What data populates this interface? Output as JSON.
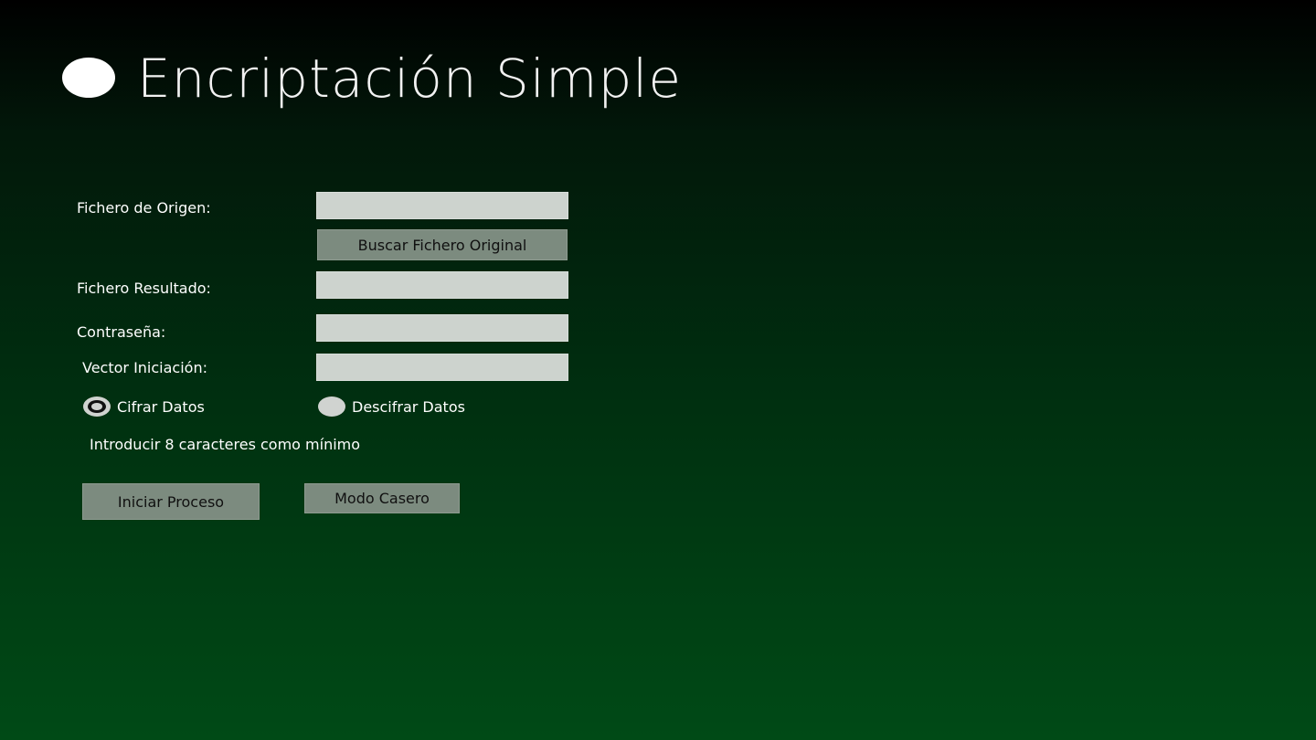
{
  "app": {
    "title": "Encriptación Simple",
    "icon": "circle-logo-icon"
  },
  "form": {
    "origin_label": "Fichero de Origen:",
    "origin_value": "",
    "browse_button": "Buscar Fichero Original",
    "result_label": "Fichero Resultado:",
    "result_value": "",
    "password_label": "Contraseña:",
    "password_value": "",
    "iv_label": "Vector Iniciación:",
    "iv_value": "",
    "encrypt_option": "Cifrar Datos",
    "decrypt_option": "Descifrar Datos",
    "selected_option": "Cifrar Datos",
    "hint": "Introducir 8 caracteres como mínimo",
    "start_button": "Iniciar Proceso",
    "home_mode_button": "Modo Casero"
  },
  "colors": {
    "background_top": "#000000",
    "background_bottom": "#004a16",
    "field_background": "#cdd3ce",
    "button_background": "#7c8b7f"
  }
}
